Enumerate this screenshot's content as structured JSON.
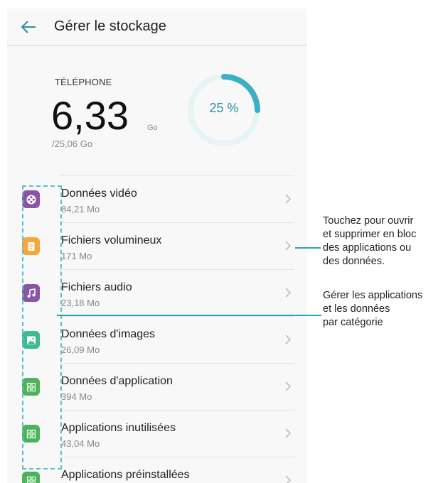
{
  "header": {
    "back_icon": "arrow-left-icon",
    "title": "Gérer le stockage"
  },
  "storage": {
    "label": "TÉLÉPHONE",
    "used_value": "6,33",
    "used_unit": "Go",
    "total": "/25,06  Go",
    "percent_label": "25 %",
    "percent_used": 0.25,
    "gauge_color": "#3ab0c3",
    "gauge_track_color": "#e7f4f6"
  },
  "categories": [
    {
      "title": "Données vidéo",
      "size": "84,21  Mo",
      "icon": "video-reel-icon",
      "color": "#8a55a6"
    },
    {
      "title": "Fichiers volumineux",
      "size": "171  Mo",
      "icon": "document-icon",
      "color": "#f4a83c"
    },
    {
      "title": "Fichiers audio",
      "size": "23,18  Mo",
      "icon": "music-note-icon",
      "color": "#8a55a6"
    },
    {
      "title": "Données d'images",
      "size": "26,09  Mo",
      "icon": "image-icon",
      "color": "#3fba93"
    },
    {
      "title": "Données d'application",
      "size": "394  Mo",
      "icon": "apps-grid-icon",
      "color": "#4cb35a"
    },
    {
      "title": "Applications inutilisées",
      "size": "43,04  Mo",
      "icon": "apps-grid-icon",
      "color": "#4cb35a"
    },
    {
      "title": "Applications préinstallées",
      "size": "",
      "icon": "apps-grid-icon",
      "color": "#4cb35a"
    }
  ],
  "callouts": {
    "open_and_delete": "Touchez pour ouvrir\net supprimer en bloc\ndes applications ou\ndes données.",
    "manage_by_category": "Gérer les applications\net les données\npar catégorie"
  },
  "colors": {
    "accent": "#2aa6b0",
    "dash_outline": "#59c1c9"
  }
}
